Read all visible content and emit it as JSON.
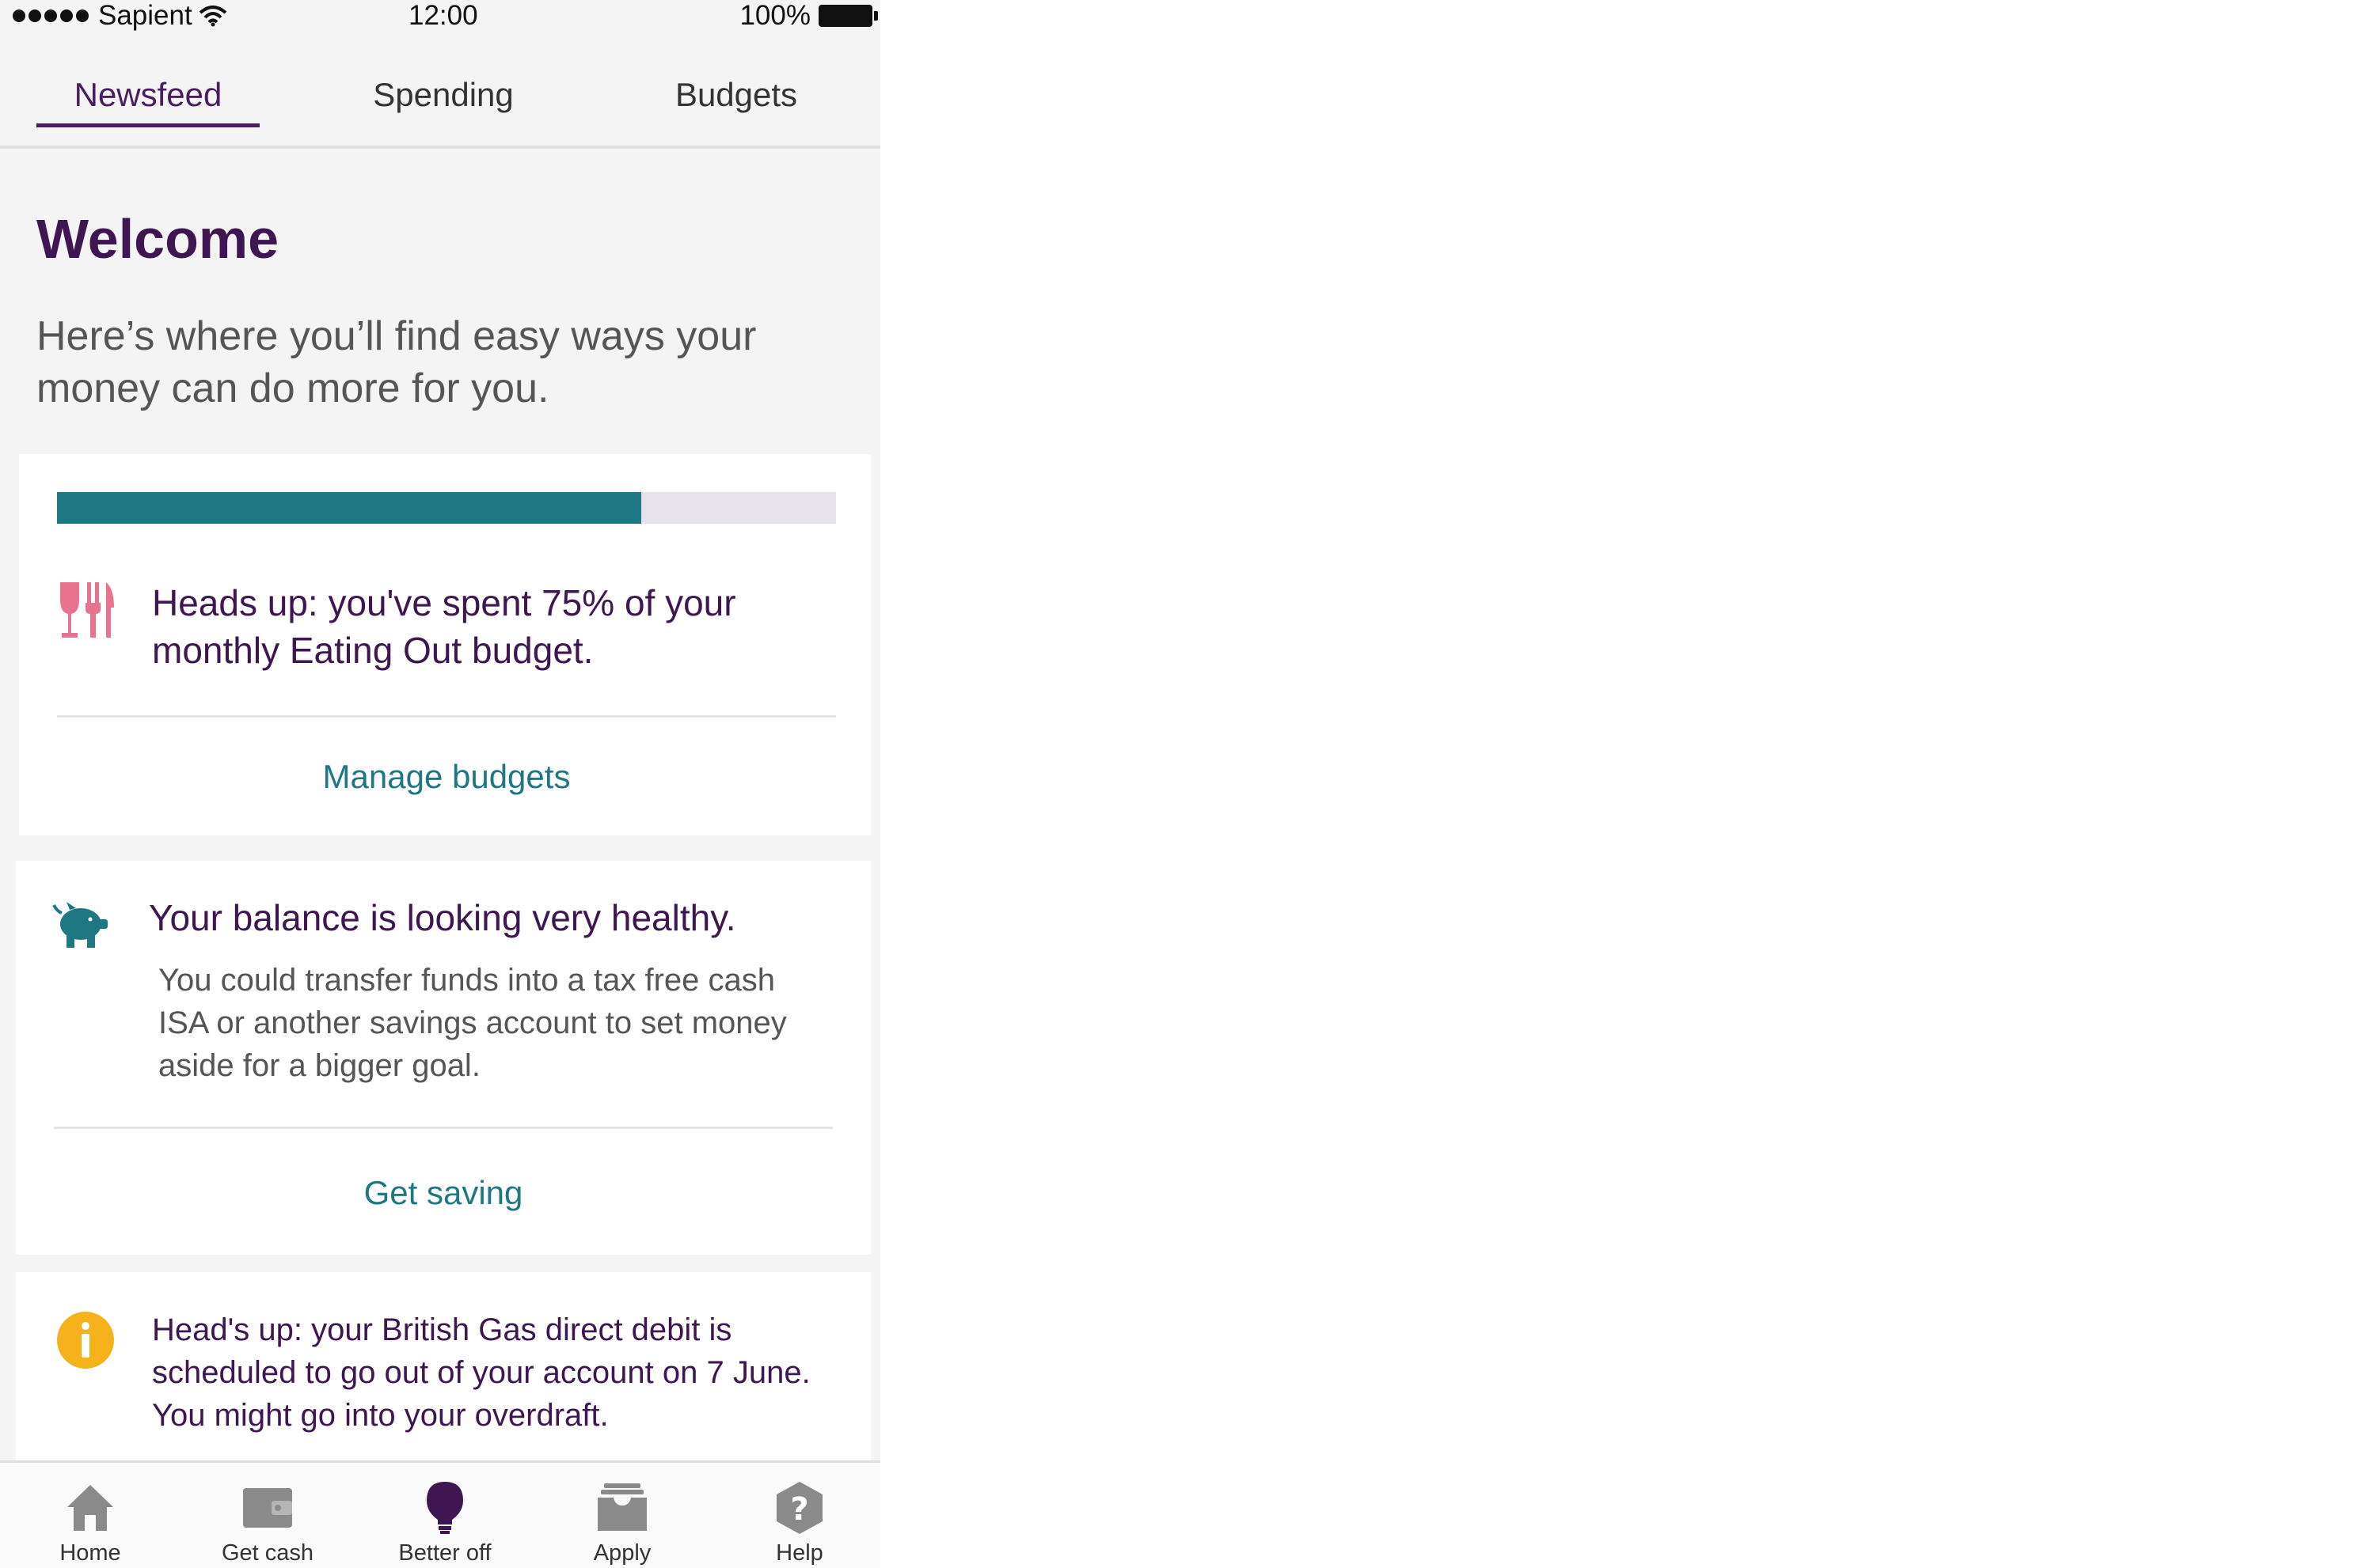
{
  "status_bar": {
    "carrier": "Sapient",
    "time": "12:00",
    "battery": "100%"
  },
  "tabs": [
    {
      "label": "Newsfeed",
      "active": true
    },
    {
      "label": "Spending",
      "active": false
    },
    {
      "label": "Budgets",
      "active": false
    }
  ],
  "welcome": {
    "title": "Welcome",
    "subtitle": "Here’s where you’ll find easy ways your money can do more for you."
  },
  "cards": {
    "budget": {
      "progress_percent": 75,
      "icon": "cutlery-icon",
      "text": "Heads up: you've spent 75% of your monthly Eating Out budget.",
      "link": "Manage budgets"
    },
    "savings": {
      "icon": "piggy-bank-icon",
      "title": "Your balance is looking very healthy.",
      "body": "You could transfer funds into a tax free cash ISA or another savings account to set money aside for a bigger goal.",
      "link": "Get saving"
    },
    "direct_debit": {
      "icon": "info-icon",
      "text": "Head's up: your British Gas direct debit is scheduled to go out of your account on 7 June. You might go into your overdraft."
    }
  },
  "bottom_nav": [
    {
      "label": "Home",
      "icon": "home-icon"
    },
    {
      "label": "Get cash",
      "icon": "wallet-icon"
    },
    {
      "label": "Better off",
      "icon": "lightbulb-icon",
      "active": true
    },
    {
      "label": "Apply",
      "icon": "inbox-icon"
    },
    {
      "label": "Help",
      "icon": "help-icon"
    }
  ],
  "colors": {
    "brand_purple": "#3d1652",
    "teal": "#1e7883",
    "pink": "#e9738f",
    "yellow": "#f5b21b",
    "nav_icon_grey": "#8a8a8a"
  }
}
